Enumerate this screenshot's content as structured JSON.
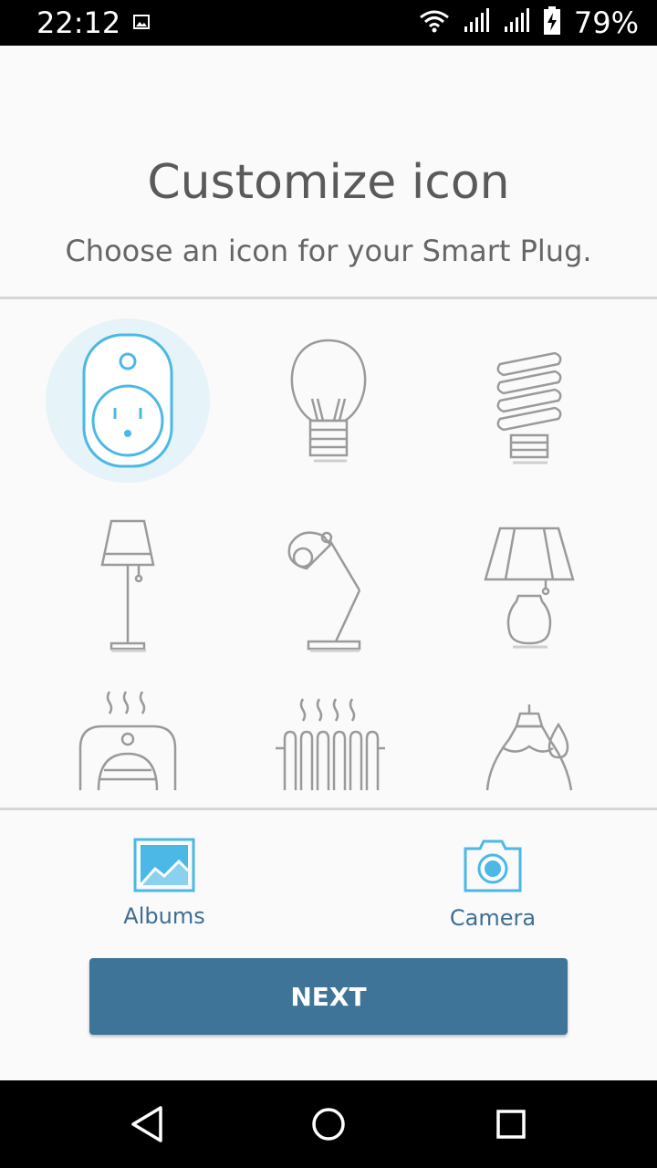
{
  "status_bar": {
    "time": "22:12",
    "battery": "79%"
  },
  "header": {
    "title": "Customize icon",
    "subtitle": "Choose an icon for your Smart Plug."
  },
  "icons": [
    {
      "name": "smart-plug-icon",
      "selected": true
    },
    {
      "name": "light-bulb-icon",
      "selected": false
    },
    {
      "name": "cfl-bulb-icon",
      "selected": false
    },
    {
      "name": "floor-lamp-icon",
      "selected": false
    },
    {
      "name": "desk-lamp-icon",
      "selected": false
    },
    {
      "name": "table-lamp-icon",
      "selected": false
    },
    {
      "name": "space-heater-icon",
      "selected": false
    },
    {
      "name": "radiator-icon",
      "selected": false
    },
    {
      "name": "humidifier-icon",
      "selected": false
    }
  ],
  "sources": {
    "albums_label": "Albums",
    "camera_label": "Camera"
  },
  "actions": {
    "next_label": "NEXT"
  },
  "colors": {
    "accent": "#4bb8e6",
    "button": "#3f7499",
    "label": "#3e6e96",
    "selected_bg": "#e6f3f8"
  }
}
